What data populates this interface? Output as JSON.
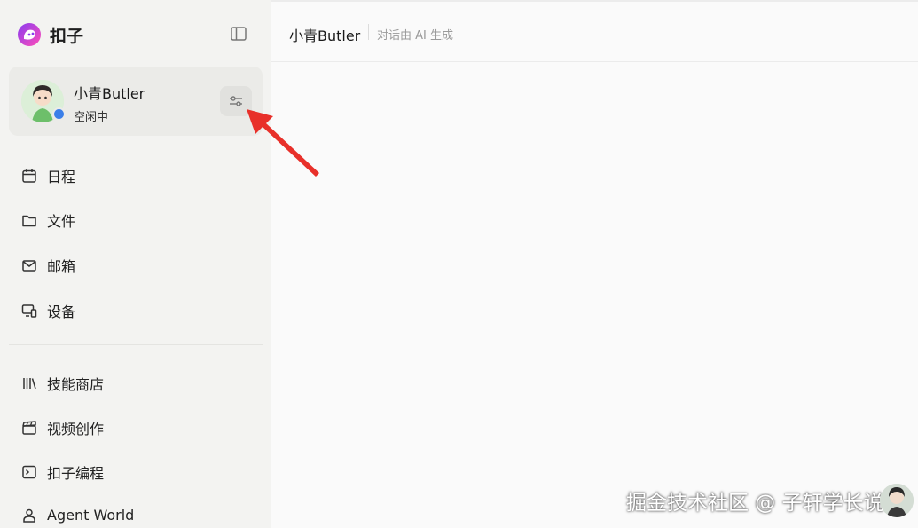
{
  "brand": {
    "name": "扣子"
  },
  "agent": {
    "name": "小青Butler",
    "status": "空闲中"
  },
  "nav_primary": [
    {
      "label": "日程",
      "icon": "calendar-icon"
    },
    {
      "label": "文件",
      "icon": "folder-icon"
    },
    {
      "label": "邮箱",
      "icon": "mail-icon"
    },
    {
      "label": "设备",
      "icon": "device-icon"
    }
  ],
  "nav_secondary": [
    {
      "label": "技能商店",
      "icon": "library-icon"
    },
    {
      "label": "视频创作",
      "icon": "clapperboard-icon"
    },
    {
      "label": "扣子编程",
      "icon": "terminal-icon"
    },
    {
      "label": "Agent World",
      "icon": "person-icon"
    }
  ],
  "header": {
    "title": "小青Butler",
    "subtitle": "对话由 AI 生成"
  },
  "watermark": {
    "text": "掘金技术社区 @ 子轩学长说"
  },
  "colors": {
    "sidebar_bg": "#f3f3f1",
    "status_dot": "#3b7fe8",
    "arrow": "#e8302a",
    "logo_gradient": [
      "#8a3cf0",
      "#ff4db8"
    ]
  }
}
